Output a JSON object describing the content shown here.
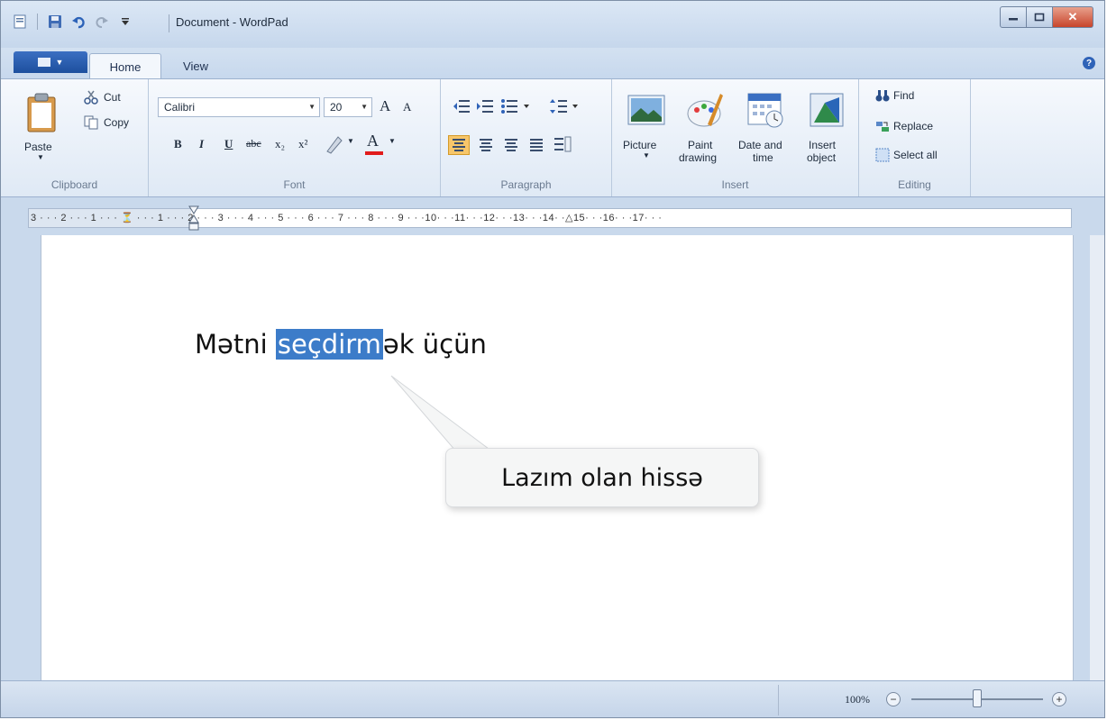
{
  "window": {
    "title": "Document - WordPad",
    "close_label": "✕"
  },
  "quick_access": {
    "icons": [
      "wordpad-icon",
      "save-icon",
      "undo-icon",
      "redo-icon",
      "customize-dropdown-icon"
    ]
  },
  "tabs": [
    {
      "label": "Home",
      "active": true
    },
    {
      "label": "View",
      "active": false
    }
  ],
  "help_label": "?",
  "ribbon": {
    "clipboard": {
      "group_label": "Clipboard",
      "paste": "Paste",
      "cut": "Cut",
      "copy": "Copy"
    },
    "font": {
      "group_label": "Font",
      "font_family": "Calibri",
      "font_size": "20",
      "grow": "A",
      "shrink": "A",
      "bold": "B",
      "italic": "I",
      "underline": "U",
      "strike": "abc",
      "subscript": "x₂",
      "superscript": "x²",
      "font_color": "A"
    },
    "paragraph": {
      "group_label": "Paragraph"
    },
    "insert": {
      "group_label": "Insert",
      "picture": "Picture",
      "paint_1": "Paint",
      "paint_2": "drawing",
      "date_1": "Date and",
      "date_2": "time",
      "object_1": "Insert",
      "object_2": "object"
    },
    "editing": {
      "group_label": "Editing",
      "find": "Find",
      "replace": "Replace",
      "select_all": "Select all"
    }
  },
  "ruler": {
    "text": "3 · · · 2 · · · 1 · · · ⏳ · · · 1 · · · 2 · · · 3 · · · 4 · · · 5 · · · 6 · · · 7 · · · 8 · · · 9 · · ·10· · ·11· · ·12· · ·13· · ·14· ·△15· · ·16· · ·17· · ·"
  },
  "document": {
    "text_before": "Mətni ",
    "selected_text": "seçdirm",
    "text_after": "ək üçün"
  },
  "callout": {
    "text": "Lazım olan hissə"
  },
  "status": {
    "zoom": "100%",
    "zoom_level_fraction": 0.5
  },
  "colors": {
    "selection": "#3c7cc9",
    "active_align": "#f7c66a",
    "ribbon_bg": "#dfe9f5"
  }
}
